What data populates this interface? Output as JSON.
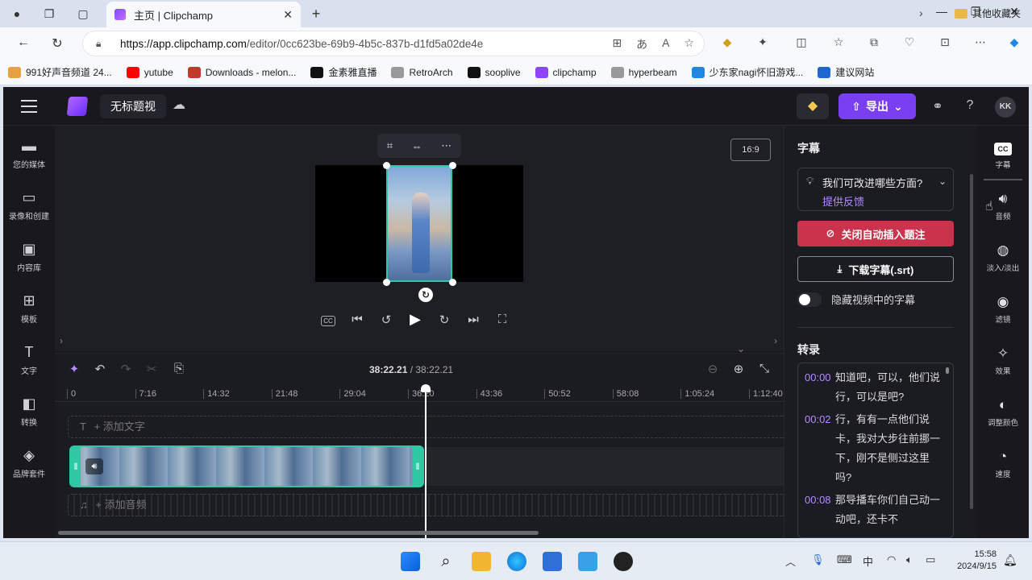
{
  "browser": {
    "tab_title": "主页 | Clipchamp",
    "tab_close": "✕",
    "new_tab": "+",
    "url_host": "https://app.clipchamp.com",
    "url_path": "/editor/0cc623be-69b9-4b5c-837b-d1fd5a02de4e",
    "bookmarks": [
      {
        "label": "991好声音频道 24...",
        "color": "#e6a23c"
      },
      {
        "label": "yutube",
        "color": "#ff0000"
      },
      {
        "label": "Downloads - melon...",
        "color": "#c0392b"
      },
      {
        "label": "金素雅直播",
        "color": "#111111"
      },
      {
        "label": "RetroArch",
        "color": "#999999"
      },
      {
        "label": "sooplive",
        "color": "#111111"
      },
      {
        "label": "clipchamp",
        "color": "#8e44ff"
      },
      {
        "label": "hyperbeam",
        "color": "#999999"
      },
      {
        "label": "少东家nagi怀旧游戏...",
        "color": "#1e88e5"
      },
      {
        "label": "建议网站",
        "color": "#1e66d0"
      }
    ],
    "bookmarks_more": "›",
    "other_bookmarks": "其他收藏夹"
  },
  "app": {
    "project_title": "无标题视",
    "export_label": "导出",
    "avatar_initials": "KK",
    "left_nav": [
      {
        "label": "您的媒体",
        "icon": "folder-icon"
      },
      {
        "label": "录像和创建",
        "icon": "camera-icon"
      },
      {
        "label": "内容库",
        "icon": "library-icon"
      },
      {
        "label": "模板",
        "icon": "templates-icon"
      },
      {
        "label": "文字",
        "icon": "text-icon"
      },
      {
        "label": "转换",
        "icon": "transition-icon"
      },
      {
        "label": "品牌套件",
        "icon": "brand-kit-icon"
      }
    ],
    "aspect_ratio": "16:9",
    "timeline": {
      "current_time": "38:22.21",
      "total_time": "/ 38:22.21",
      "ticks": [
        "0",
        "7:16",
        "14:32",
        "21:48",
        "29:04",
        "36:20",
        "43:36",
        "50:52",
        "58:08",
        "1:05:24",
        "1:12:40"
      ],
      "add_text": "+ 添加文字",
      "add_audio": "+ 添加音频"
    },
    "captions_panel": {
      "title": "字幕",
      "feedback_question": "我们可改进哪些方面?",
      "feedback_link": "提供反馈",
      "disable_auto_btn": "关闭自动插入题注",
      "download_btn": "下载字幕(.srt)",
      "hide_captions_label": "隐藏视频中的字幕",
      "transcript_title": "转录",
      "transcript": [
        {
          "time": "00:00",
          "text": "知道吧，可以，他们说行，可以是吧?"
        },
        {
          "time": "00:02",
          "text": "行，有有一点他们说卡，我对大步往前挪一下，刚不是侧过这里吗?"
        },
        {
          "time": "00:08",
          "text": "那导播车你们自己动一动吧，还卡不"
        }
      ]
    },
    "right_rail": [
      {
        "label": "字幕",
        "icon": "captions-icon"
      },
      {
        "label": "音频",
        "icon": "audio-icon"
      },
      {
        "label": "淡入/淡出",
        "icon": "fade-icon"
      },
      {
        "label": "滤镜",
        "icon": "filters-icon"
      },
      {
        "label": "效果",
        "icon": "effects-icon"
      },
      {
        "label": "调整颜色",
        "icon": "adjust-color-icon"
      },
      {
        "label": "速度",
        "icon": "speed-icon"
      }
    ]
  },
  "taskbar": {
    "ime": "中",
    "time": "15:58",
    "date": "2024/9/15"
  }
}
